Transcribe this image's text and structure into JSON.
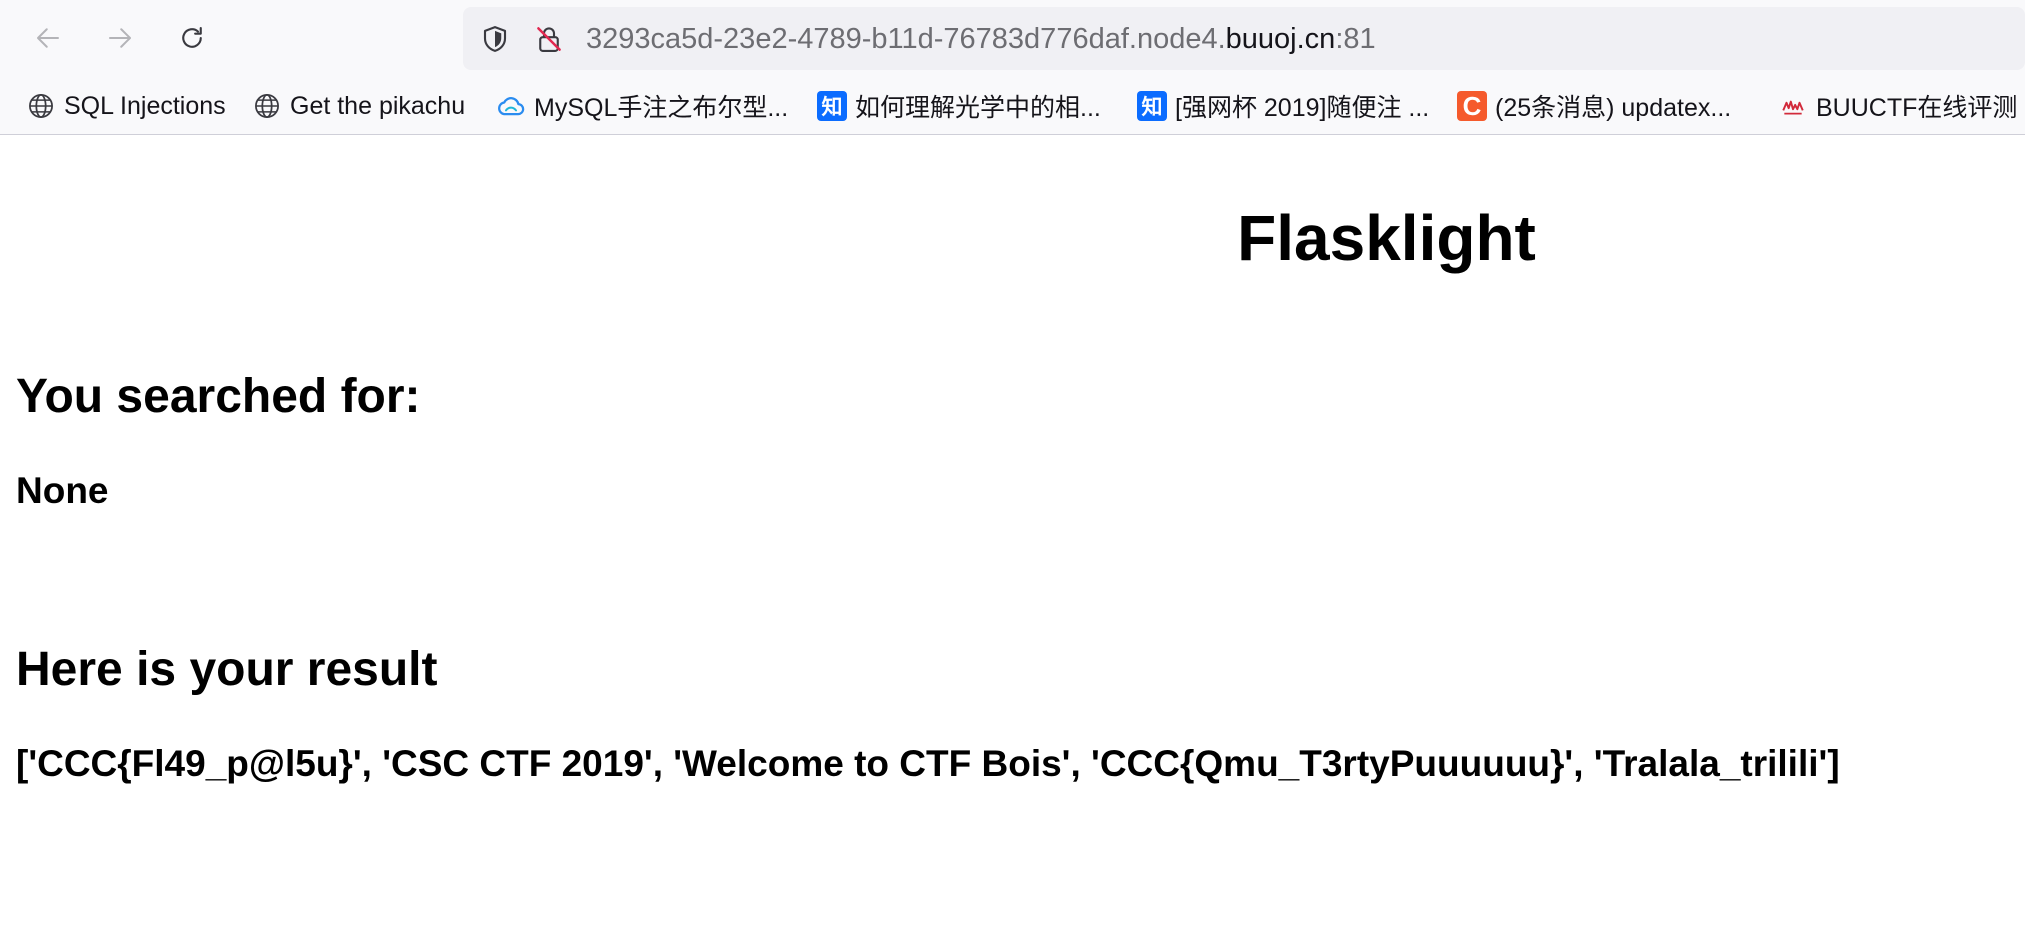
{
  "browser": {
    "url_prefix": "3293ca5d-23e2-4789-b11d-76783d776daf.node4.",
    "url_host": "buuoj.cn",
    "url_port": ":81",
    "bookmarks": [
      {
        "label": "SQL Injections",
        "icon": "globe-icon"
      },
      {
        "label": "Get the pikachu",
        "icon": "globe-icon"
      },
      {
        "label": "MySQL手注之布尔型...",
        "icon": "cloud-icon"
      },
      {
        "label": "如何理解光学中的相...",
        "icon": "zhihu-icon",
        "icon_text": "知"
      },
      {
        "label": "[强网杯 2019]随便注 ...",
        "icon": "zhihu-icon",
        "icon_text": "知"
      },
      {
        "label": "(25条消息) updatex...",
        "icon": "csdn-icon",
        "icon_text": "C"
      },
      {
        "label": "BUUCTF在线评测",
        "icon": "buuctf-icon"
      }
    ]
  },
  "page": {
    "title": "Flasklight",
    "searched_heading": "You searched for:",
    "searched_value": "None",
    "result_heading": "Here is your result",
    "result_value": "['CCC{Fl49_p@l5u}', 'CSC CTF 2019', 'Welcome to CTF Bois', 'CCC{Qmu_T3rtyPuuuuuu}', 'Tralala_trilili']"
  },
  "colors": {
    "chrome_bg": "#f9f9fb",
    "urlbar_bg": "#f0f0f4",
    "zhihu_blue": "#0b6cff",
    "csdn_orange": "#f55a2c",
    "insecure_red": "#e22850"
  }
}
